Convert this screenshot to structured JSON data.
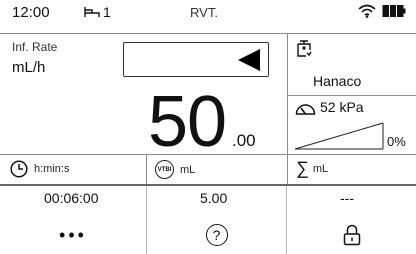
{
  "status_bar": {
    "time": "12:00",
    "bed_number": "1",
    "mode": "RVT."
  },
  "rate": {
    "label": "Inf. Rate",
    "unit": "mL/h",
    "value_integer": "50",
    "value_decimal": ".00"
  },
  "drug": {
    "name": "Hanaco"
  },
  "pressure": {
    "value": "52 kPa",
    "percent": "0%"
  },
  "time_remaining": {
    "label": "h:min:s",
    "value": "00:06:00"
  },
  "vtbi": {
    "icon_text": "VTBI",
    "label": "mL",
    "value": "5.00"
  },
  "total_volume": {
    "symbol": "∑",
    "label": "mL",
    "value": "---"
  },
  "bottom_bar": {
    "more": "•••",
    "help": "?"
  },
  "icons": {
    "bed": "bed-icon",
    "wifi": "wifi-icon",
    "battery": "battery-icon",
    "direction": "arrow-left-triangle-icon",
    "syringe": "syringe-icon",
    "pressure": "pressure-gauge-icon",
    "clock": "clock-icon",
    "lock": "lock-icon"
  },
  "colors": {
    "battery_fill": "#111111",
    "divider": "#8a8a8a"
  }
}
